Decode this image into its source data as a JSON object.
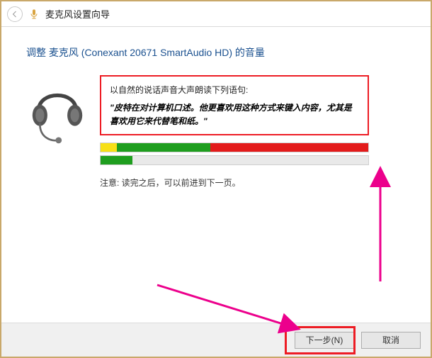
{
  "titlebar": {
    "title": "麦克风设置向导"
  },
  "heading": "调整 麦克风 (Conexant 20671 SmartAudio HD) 的音量",
  "instruction": {
    "line1": "以自然的说话声音大声朗读下列语句:",
    "sentence": "\"皮特在对计算机口述。他更喜欢用这种方式来键入内容，尤其是喜欢用它来代替笔和纸。\""
  },
  "meters": {
    "bar1": [
      {
        "color": "#f7e017",
        "start": 0,
        "end": 6
      },
      {
        "color": "#1f9e1f",
        "start": 6,
        "end": 41
      },
      {
        "color": "#e31b1b",
        "start": 41,
        "end": 100
      }
    ],
    "bar2": [
      {
        "color": "#1f9e1f",
        "start": 0,
        "end": 12
      }
    ]
  },
  "note": "注意: 读完之后，可以前进到下一页。",
  "footer": {
    "next": "下一步(N)",
    "cancel": "取消"
  },
  "colors": {
    "annotation_red": "#ed1c24",
    "annotation_magenta": "#ec008c"
  }
}
